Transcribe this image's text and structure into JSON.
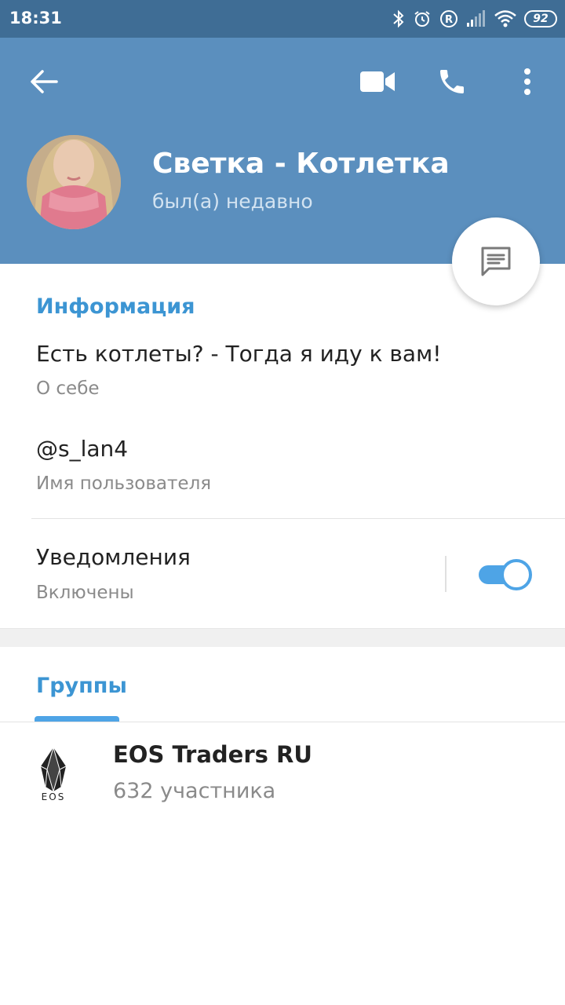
{
  "status_bar": {
    "time": "18:31",
    "battery": "92",
    "icons": [
      "bluetooth-icon",
      "alarm-icon",
      "roaming-icon",
      "signal-icon",
      "wifi-icon",
      "battery-icon"
    ]
  },
  "header": {
    "name": "Светка - Котлетка",
    "status": "был(а) недавно",
    "actions": [
      "back-arrow-icon",
      "video-call-icon",
      "phone-icon",
      "more-vert-icon"
    ]
  },
  "info": {
    "title": "Информация",
    "bio": "Есть котлеты? - Тогда я иду к вам!",
    "bio_label": "О себе",
    "username": "@s_lan4",
    "username_label": "Имя пользователя",
    "notifications": "Уведомления",
    "notifications_state": "Включены",
    "notifications_enabled": true
  },
  "groups": {
    "title": "Группы",
    "items": [
      {
        "name": "EOS Traders RU",
        "members": "632 участника",
        "logo_text": "EOS"
      }
    ]
  },
  "colors": {
    "header": "#5b8fbe",
    "status_bar": "#3f6d95",
    "accent": "#3c95d3",
    "toggle": "#4ea4e6"
  }
}
